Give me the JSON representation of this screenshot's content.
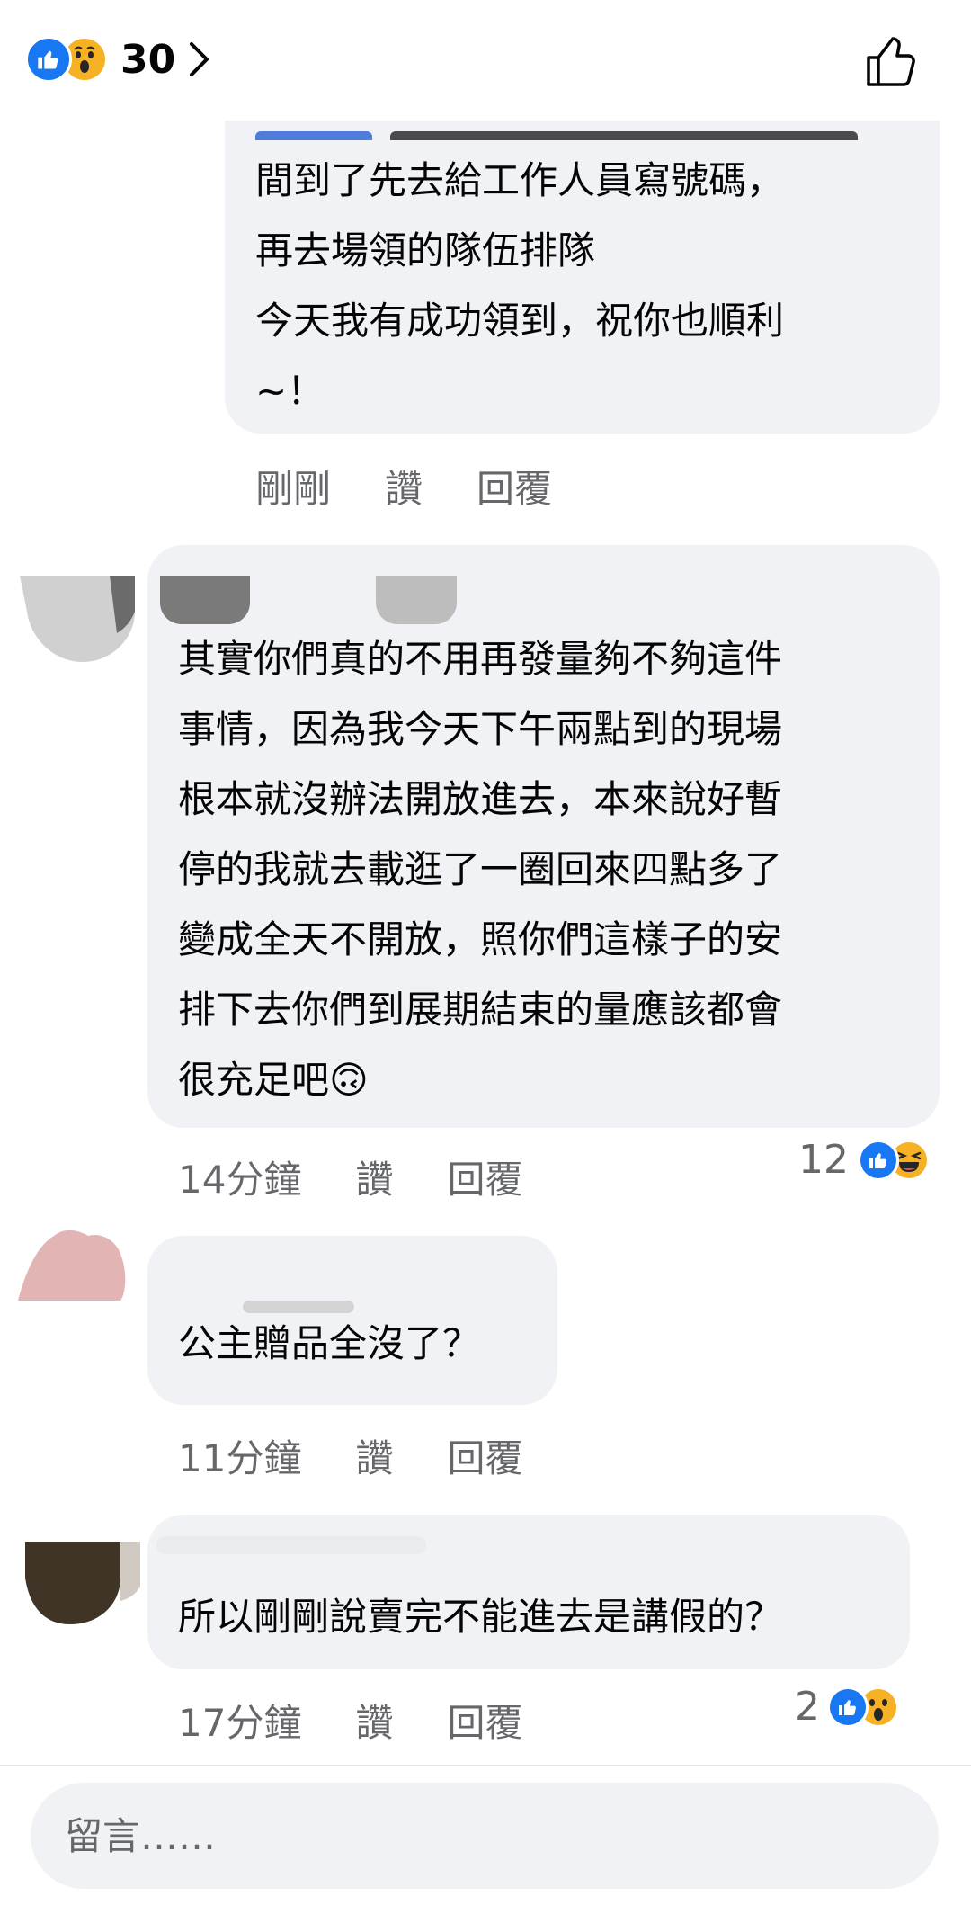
{
  "header": {
    "reaction_count": "30",
    "reaction_types": [
      "like",
      "wow"
    ]
  },
  "comments": [
    {
      "text": "間到了先去給工作人員寫號碼，\n再去場領的隊伍排隊\n今天我有成功領到，祝你也順利\n~！",
      "time": "剛剛",
      "like_label": "讚",
      "reply_label": "回覆"
    },
    {
      "text": "其實你們真的不用再發量夠不夠這件\n事情，因為我今天下午兩點到的現場\n根本就沒辦法開放進去，本來說好暫\n停的我就去載逛了一圈回來四點多了\n變成全天不開放，照你們這樣子的安\n排下去你們到展期結束的量應該都會\n很充足吧🙃",
      "time": "14分鐘",
      "like_label": "讚",
      "reply_label": "回覆",
      "reaction_count": "12",
      "reaction_types": [
        "like",
        "haha"
      ]
    },
    {
      "text": "公主贈品全沒了？",
      "time": "11分鐘",
      "like_label": "讚",
      "reply_label": "回覆"
    },
    {
      "text": "所以剛剛說賣完不能進去是講假的？",
      "time": "17分鐘",
      "like_label": "讚",
      "reply_label": "回覆",
      "reaction_count": "2",
      "reaction_types": [
        "like",
        "wow"
      ]
    }
  ],
  "composer": {
    "placeholder": "留言……"
  },
  "colors": {
    "like_blue": "#1877f2",
    "emoji_yellow": "#f7b125",
    "bubble_bg": "#f0f2f5",
    "meta_gray": "#65676b"
  }
}
